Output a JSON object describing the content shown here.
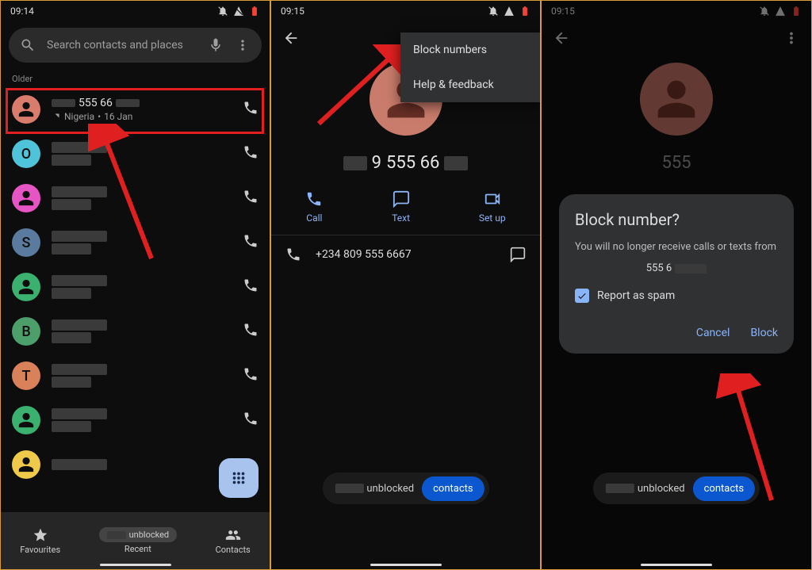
{
  "pane1": {
    "time": "09:14",
    "search_placeholder": "Search contacts and places",
    "section_older": "Older",
    "row1_num": "555 66",
    "row1_sub_loc": "Nigeria",
    "row1_sub_date": "16 Jan",
    "nav_fav": "Favourites",
    "nav_recent": "Recent",
    "nav_contacts": "Contacts",
    "avatars": [
      "O",
      "S",
      "B",
      "T"
    ]
  },
  "pane2": {
    "time": "09:15",
    "menu_block": "Block numbers",
    "menu_help": "Help & feedback",
    "display_number": "555 66",
    "action_call": "Call",
    "action_text": "Text",
    "action_setup": "Set up",
    "detail_number": "+234 809 555 6667",
    "toast_text": "unblocked",
    "toast_chip": "contacts"
  },
  "pane3": {
    "time": "09:15",
    "partial_number": "555",
    "dialog_title": "Block number?",
    "dialog_body": "You will no longer receive calls or texts from",
    "dialog_number": "555 6",
    "dialog_checkbox": "Report as spam",
    "dialog_cancel": "Cancel",
    "dialog_block": "Block",
    "toast_text": "unblocked",
    "toast_chip": "contacts"
  }
}
